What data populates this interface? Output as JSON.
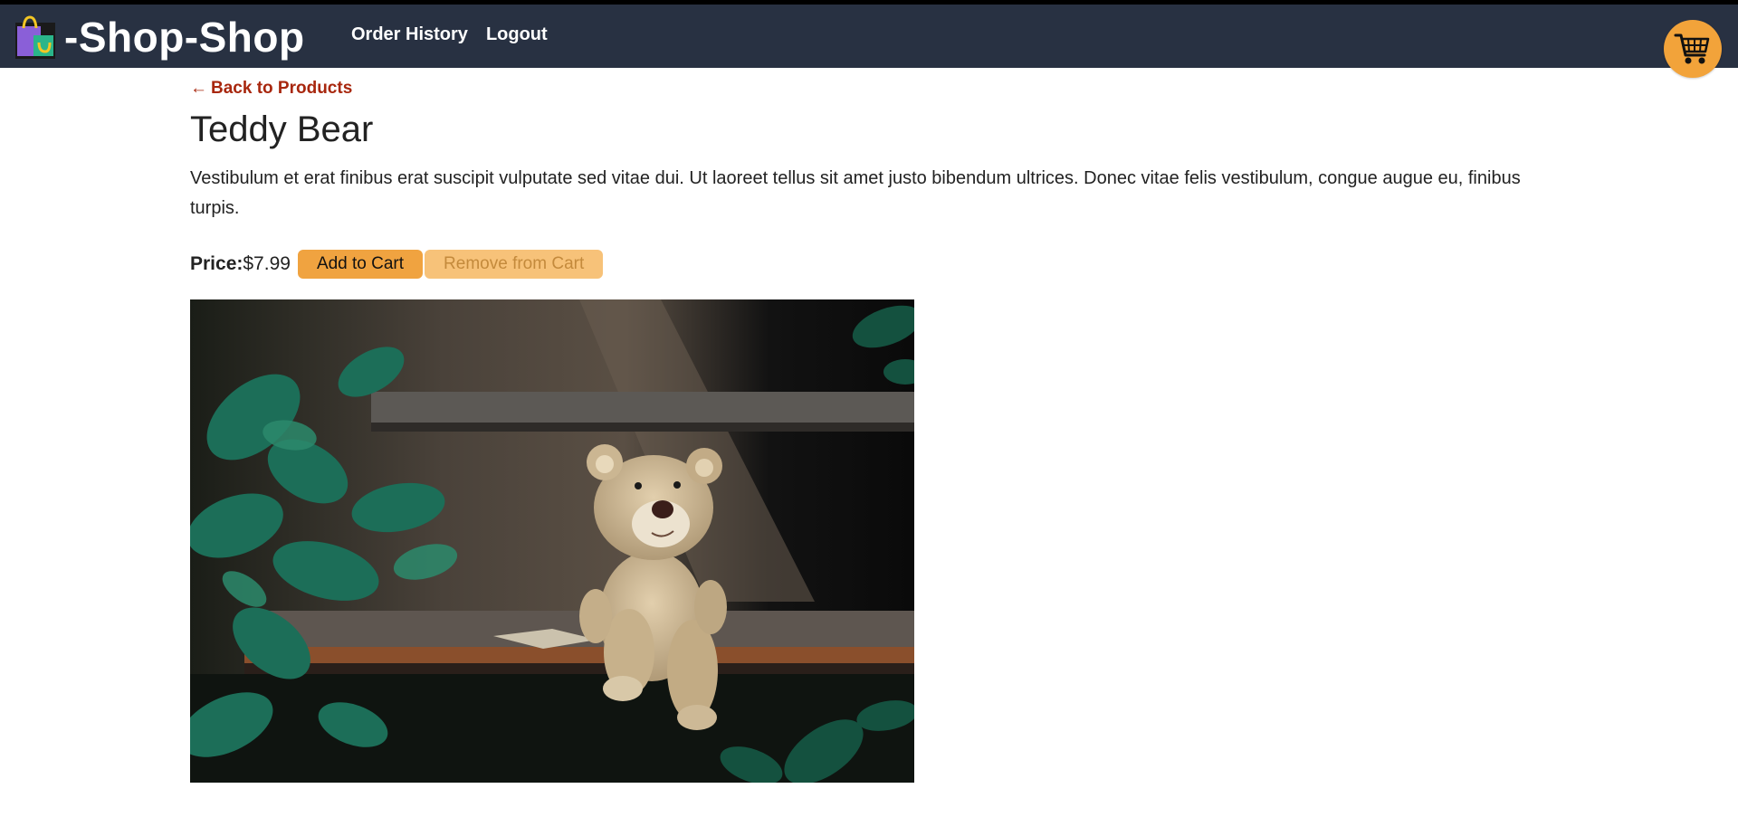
{
  "brand": {
    "name": "-Shop-Shop",
    "icon": "shopping-bag-logo-icon"
  },
  "nav": {
    "order_history": "Order History",
    "logout": "Logout"
  },
  "cart": {
    "icon": "shopping-cart-icon"
  },
  "product": {
    "back_arrow": "←",
    "back_label": "Back to Products",
    "name": "Teddy Bear",
    "description": "Vestibulum et erat finibus erat suscipit vulputate sed vitae dui. Ut laoreet tellus sit amet justo bibendum ultrices. Donec vitae felis vestibulum, congue augue eu, finibus turpis.",
    "price_label": "Price:",
    "price": "$7.99",
    "add_label": "Add to Cart",
    "remove_label": "Remove from Cart"
  },
  "colors": {
    "header_bg": "#283142",
    "accent": "#f0a340",
    "link": "#a8270e"
  }
}
